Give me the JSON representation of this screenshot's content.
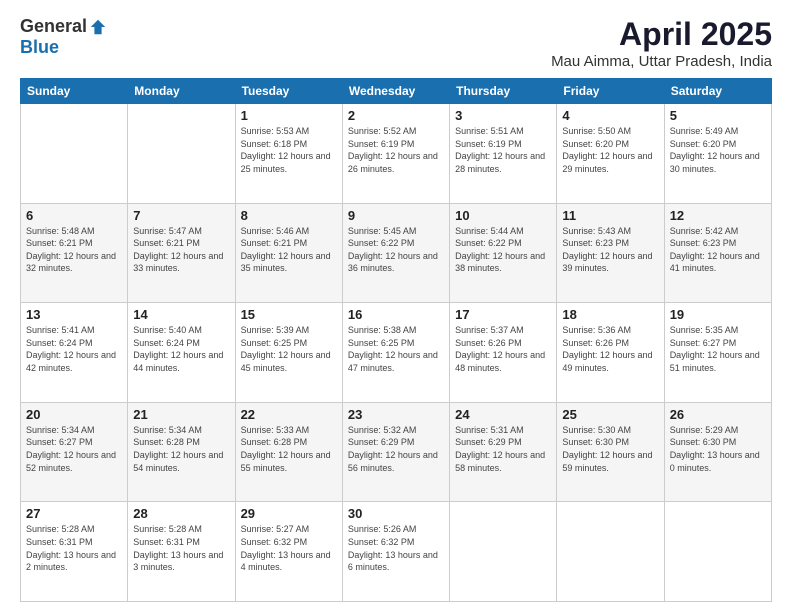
{
  "header": {
    "logo_general": "General",
    "logo_blue": "Blue",
    "title": "April 2025",
    "location": "Mau Aimma, Uttar Pradesh, India"
  },
  "days_of_week": [
    "Sunday",
    "Monday",
    "Tuesday",
    "Wednesday",
    "Thursday",
    "Friday",
    "Saturday"
  ],
  "weeks": [
    [
      {
        "day": "",
        "sunrise": "",
        "sunset": "",
        "daylight": ""
      },
      {
        "day": "",
        "sunrise": "",
        "sunset": "",
        "daylight": ""
      },
      {
        "day": "1",
        "sunrise": "Sunrise: 5:53 AM",
        "sunset": "Sunset: 6:18 PM",
        "daylight": "Daylight: 12 hours and 25 minutes."
      },
      {
        "day": "2",
        "sunrise": "Sunrise: 5:52 AM",
        "sunset": "Sunset: 6:19 PM",
        "daylight": "Daylight: 12 hours and 26 minutes."
      },
      {
        "day": "3",
        "sunrise": "Sunrise: 5:51 AM",
        "sunset": "Sunset: 6:19 PM",
        "daylight": "Daylight: 12 hours and 28 minutes."
      },
      {
        "day": "4",
        "sunrise": "Sunrise: 5:50 AM",
        "sunset": "Sunset: 6:20 PM",
        "daylight": "Daylight: 12 hours and 29 minutes."
      },
      {
        "day": "5",
        "sunrise": "Sunrise: 5:49 AM",
        "sunset": "Sunset: 6:20 PM",
        "daylight": "Daylight: 12 hours and 30 minutes."
      }
    ],
    [
      {
        "day": "6",
        "sunrise": "Sunrise: 5:48 AM",
        "sunset": "Sunset: 6:21 PM",
        "daylight": "Daylight: 12 hours and 32 minutes."
      },
      {
        "day": "7",
        "sunrise": "Sunrise: 5:47 AM",
        "sunset": "Sunset: 6:21 PM",
        "daylight": "Daylight: 12 hours and 33 minutes."
      },
      {
        "day": "8",
        "sunrise": "Sunrise: 5:46 AM",
        "sunset": "Sunset: 6:21 PM",
        "daylight": "Daylight: 12 hours and 35 minutes."
      },
      {
        "day": "9",
        "sunrise": "Sunrise: 5:45 AM",
        "sunset": "Sunset: 6:22 PM",
        "daylight": "Daylight: 12 hours and 36 minutes."
      },
      {
        "day": "10",
        "sunrise": "Sunrise: 5:44 AM",
        "sunset": "Sunset: 6:22 PM",
        "daylight": "Daylight: 12 hours and 38 minutes."
      },
      {
        "day": "11",
        "sunrise": "Sunrise: 5:43 AM",
        "sunset": "Sunset: 6:23 PM",
        "daylight": "Daylight: 12 hours and 39 minutes."
      },
      {
        "day": "12",
        "sunrise": "Sunrise: 5:42 AM",
        "sunset": "Sunset: 6:23 PM",
        "daylight": "Daylight: 12 hours and 41 minutes."
      }
    ],
    [
      {
        "day": "13",
        "sunrise": "Sunrise: 5:41 AM",
        "sunset": "Sunset: 6:24 PM",
        "daylight": "Daylight: 12 hours and 42 minutes."
      },
      {
        "day": "14",
        "sunrise": "Sunrise: 5:40 AM",
        "sunset": "Sunset: 6:24 PM",
        "daylight": "Daylight: 12 hours and 44 minutes."
      },
      {
        "day": "15",
        "sunrise": "Sunrise: 5:39 AM",
        "sunset": "Sunset: 6:25 PM",
        "daylight": "Daylight: 12 hours and 45 minutes."
      },
      {
        "day": "16",
        "sunrise": "Sunrise: 5:38 AM",
        "sunset": "Sunset: 6:25 PM",
        "daylight": "Daylight: 12 hours and 47 minutes."
      },
      {
        "day": "17",
        "sunrise": "Sunrise: 5:37 AM",
        "sunset": "Sunset: 6:26 PM",
        "daylight": "Daylight: 12 hours and 48 minutes."
      },
      {
        "day": "18",
        "sunrise": "Sunrise: 5:36 AM",
        "sunset": "Sunset: 6:26 PM",
        "daylight": "Daylight: 12 hours and 49 minutes."
      },
      {
        "day": "19",
        "sunrise": "Sunrise: 5:35 AM",
        "sunset": "Sunset: 6:27 PM",
        "daylight": "Daylight: 12 hours and 51 minutes."
      }
    ],
    [
      {
        "day": "20",
        "sunrise": "Sunrise: 5:34 AM",
        "sunset": "Sunset: 6:27 PM",
        "daylight": "Daylight: 12 hours and 52 minutes."
      },
      {
        "day": "21",
        "sunrise": "Sunrise: 5:34 AM",
        "sunset": "Sunset: 6:28 PM",
        "daylight": "Daylight: 12 hours and 54 minutes."
      },
      {
        "day": "22",
        "sunrise": "Sunrise: 5:33 AM",
        "sunset": "Sunset: 6:28 PM",
        "daylight": "Daylight: 12 hours and 55 minutes."
      },
      {
        "day": "23",
        "sunrise": "Sunrise: 5:32 AM",
        "sunset": "Sunset: 6:29 PM",
        "daylight": "Daylight: 12 hours and 56 minutes."
      },
      {
        "day": "24",
        "sunrise": "Sunrise: 5:31 AM",
        "sunset": "Sunset: 6:29 PM",
        "daylight": "Daylight: 12 hours and 58 minutes."
      },
      {
        "day": "25",
        "sunrise": "Sunrise: 5:30 AM",
        "sunset": "Sunset: 6:30 PM",
        "daylight": "Daylight: 12 hours and 59 minutes."
      },
      {
        "day": "26",
        "sunrise": "Sunrise: 5:29 AM",
        "sunset": "Sunset: 6:30 PM",
        "daylight": "Daylight: 13 hours and 0 minutes."
      }
    ],
    [
      {
        "day": "27",
        "sunrise": "Sunrise: 5:28 AM",
        "sunset": "Sunset: 6:31 PM",
        "daylight": "Daylight: 13 hours and 2 minutes."
      },
      {
        "day": "28",
        "sunrise": "Sunrise: 5:28 AM",
        "sunset": "Sunset: 6:31 PM",
        "daylight": "Daylight: 13 hours and 3 minutes."
      },
      {
        "day": "29",
        "sunrise": "Sunrise: 5:27 AM",
        "sunset": "Sunset: 6:32 PM",
        "daylight": "Daylight: 13 hours and 4 minutes."
      },
      {
        "day": "30",
        "sunrise": "Sunrise: 5:26 AM",
        "sunset": "Sunset: 6:32 PM",
        "daylight": "Daylight: 13 hours and 6 minutes."
      },
      {
        "day": "",
        "sunrise": "",
        "sunset": "",
        "daylight": ""
      },
      {
        "day": "",
        "sunrise": "",
        "sunset": "",
        "daylight": ""
      },
      {
        "day": "",
        "sunrise": "",
        "sunset": "",
        "daylight": ""
      }
    ]
  ]
}
